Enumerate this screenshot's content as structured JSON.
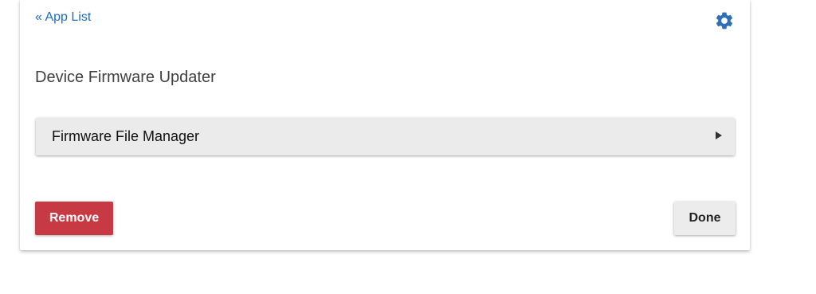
{
  "header": {
    "back_link": "« App List",
    "settings_icon": "gear-icon"
  },
  "page": {
    "title": "Device Firmware Updater"
  },
  "sections": [
    {
      "label": "Firmware File Manager",
      "icon": "triangle-right-icon"
    }
  ],
  "actions": {
    "remove_label": "Remove",
    "done_label": "Done"
  },
  "colors": {
    "link": "#1a6ec0",
    "settings_icon": "#2f6fb8",
    "remove_button": "#c83a43",
    "done_button": "#ececec",
    "section_background": "#ebebeb"
  }
}
